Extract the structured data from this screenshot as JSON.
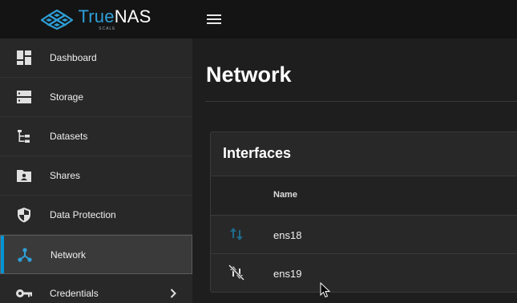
{
  "app": {
    "logo_name_part1": "True",
    "logo_name_part2": "NAS",
    "logo_sub": "SCALE",
    "brand_color": "#0095d5"
  },
  "topbar": {
    "menu_icon": "hamburger-menu-icon"
  },
  "sidebar": {
    "items": [
      {
        "label": "Dashboard",
        "icon": "dashboard-icon",
        "active": false
      },
      {
        "label": "Storage",
        "icon": "storage-icon",
        "active": false
      },
      {
        "label": "Datasets",
        "icon": "datasets-icon",
        "active": false
      },
      {
        "label": "Shares",
        "icon": "shares-icon",
        "active": false
      },
      {
        "label": "Data Protection",
        "icon": "shield-icon",
        "active": false
      },
      {
        "label": "Network",
        "icon": "network-icon",
        "active": true
      },
      {
        "label": "Credentials",
        "icon": "key-icon",
        "active": false,
        "has_submenu": true
      }
    ]
  },
  "main": {
    "page_title": "Network",
    "interfaces": {
      "title": "Interfaces",
      "columns": [
        "Name"
      ],
      "rows": [
        {
          "name": "ens18",
          "status_icon": "link-up-arrows-icon",
          "status_color": "#1e6a8a"
        },
        {
          "name": "ens19",
          "status_icon": "link-down-arrows-icon",
          "status_color": "#e0e0e0"
        }
      ]
    }
  }
}
